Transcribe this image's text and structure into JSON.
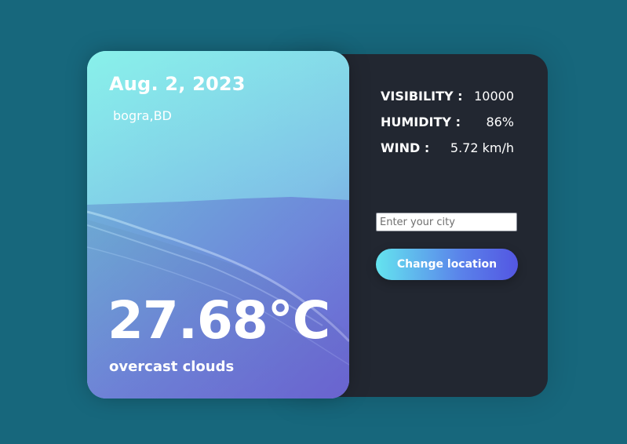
{
  "weather_card": {
    "date": "Aug. 2, 2023",
    "location": "bogra,BD",
    "temperature": "27.68°C",
    "description": "overcast clouds"
  },
  "details": {
    "visibility_label": "VISIBILITY :",
    "visibility_value": "10000",
    "humidity_label": "HUMIDITY :",
    "humidity_value": "86%",
    "wind_label": "WIND :",
    "wind_value": "5.72 km/h"
  },
  "search": {
    "placeholder": "Enter your city",
    "value": ""
  },
  "actions": {
    "change_location_label": "Change location"
  },
  "colors": {
    "page_background": "#17677c",
    "panel_background": "#222731",
    "card_gradient_start": "#8cf0ec",
    "card_gradient_end": "#6c6fd6",
    "button_gradient_start": "#64e4ef",
    "button_gradient_end": "#5356e2",
    "text": "#ffffff"
  }
}
